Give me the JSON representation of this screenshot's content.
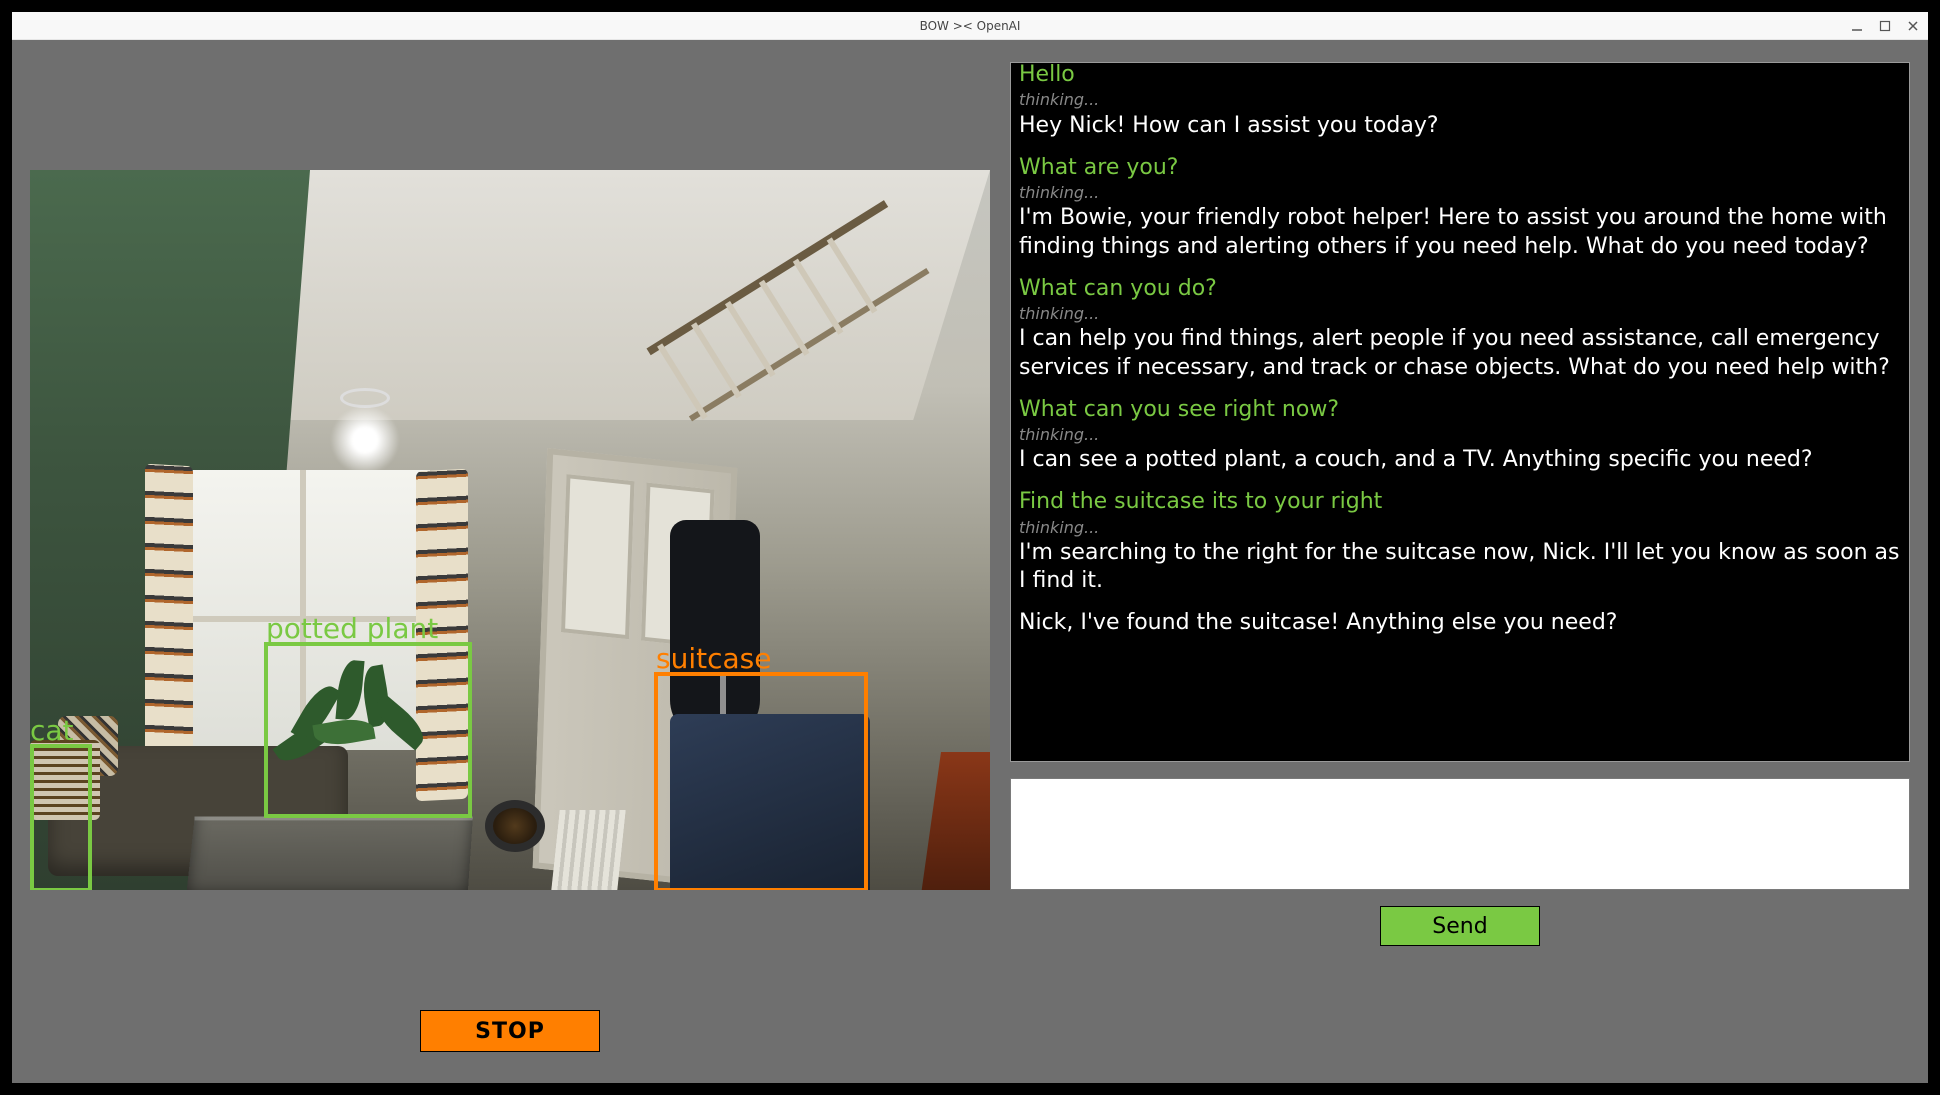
{
  "window": {
    "title": "BOW >< OpenAI"
  },
  "detections": {
    "cat": {
      "label": "cat",
      "color": "#7ac943"
    },
    "plant": {
      "label": "potted plant",
      "color": "#7ac943"
    },
    "suitcase": {
      "label": "suitcase",
      "color": "#ff7f00"
    }
  },
  "buttons": {
    "stop": "STOP",
    "send": "Send"
  },
  "thinking_label": "thinking...",
  "chat": [
    {
      "role": "user",
      "text": "Hello"
    },
    {
      "role": "thinking",
      "text": "thinking..."
    },
    {
      "role": "assistant",
      "text": "Hey Nick! How can I assist you today?"
    },
    {
      "role": "user",
      "text": "What are you?"
    },
    {
      "role": "thinking",
      "text": "thinking..."
    },
    {
      "role": "assistant",
      "text": "I'm Bowie, your friendly robot helper! Here to assist you around the home with finding things and alerting others if you need help. What do you need today?"
    },
    {
      "role": "user",
      "text": "What can you do?"
    },
    {
      "role": "thinking",
      "text": "thinking..."
    },
    {
      "role": "assistant",
      "text": "I can help you find things, alert people if you need assistance, call emergency services if necessary, and track or chase objects. What do you need help with?"
    },
    {
      "role": "user",
      "text": "What can you see right now?"
    },
    {
      "role": "thinking",
      "text": "thinking..."
    },
    {
      "role": "assistant",
      "text": "I can see a potted plant, a couch, and a TV. Anything specific you need?"
    },
    {
      "role": "user",
      "text": "Find the suitcase its to your right"
    },
    {
      "role": "thinking",
      "text": "thinking..."
    },
    {
      "role": "assistant",
      "text": "I'm searching to the right for the suitcase now, Nick. I'll let you know as soon as I find it."
    },
    {
      "role": "assistant",
      "text": "Nick, I've found the suitcase! Anything else you need?"
    }
  ],
  "input": {
    "value": ""
  }
}
